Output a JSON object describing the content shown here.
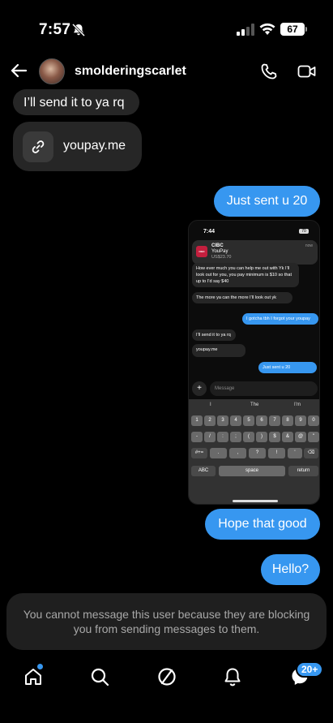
{
  "status_bar": {
    "time": "7:57",
    "battery": "67"
  },
  "header": {
    "username": "smolderingscarlet"
  },
  "messages": {
    "received_1": "I’ll send it to ya rq",
    "received_link": "youpay.me",
    "sent_1": "Just sent u 20",
    "sent_2": "Hope that good",
    "sent_3": "Hello?"
  },
  "embedded_screenshot": {
    "time": "7:44",
    "battery": "70",
    "notification": {
      "bank_logo": "CIBC",
      "bank": "CIBC",
      "app": "YouPay",
      "amount": "US$23.70",
      "time": "now"
    },
    "messages": [
      "How ever much you can help me out with Yk I’ll look out for you, you pay minimum is $10 so that up to I’d say $40",
      "The more ya can the more I’ll look out yk",
      "I gotcha tbh I forgot your youpay",
      "I’ll send it to ya rq",
      "youpay.me",
      "Just sent u 20"
    ],
    "input_placeholder": "Message",
    "predictions": [
      "I",
      "The",
      "I’m"
    ],
    "keys": {
      "row1": [
        "1",
        "2",
        "3",
        "4",
        "5",
        "6",
        "7",
        "8",
        "9",
        "0"
      ],
      "row2": [
        "-",
        "/",
        ":",
        ";",
        "(",
        ")",
        "$",
        "&",
        "@",
        "\""
      ],
      "row3": [
        "#+=",
        ".",
        ",",
        "?",
        "!",
        "'",
        "⌫"
      ],
      "row4": [
        "ABC",
        "space",
        "return"
      ]
    }
  },
  "blocked_notice": {
    "line1": "You cannot message this user because they are blocking",
    "line2": "you from sending messages to them."
  },
  "nav": {
    "messages_badge": "20+"
  },
  "colors": {
    "background": "#000000",
    "sent_bubble": "#3797f0",
    "received_bubble": "#262626",
    "notice_bg": "#1f1f1f"
  },
  "icons": [
    "mute-bell-icon",
    "cellular-signal-icon",
    "wifi-icon",
    "back-arrow-icon",
    "phone-icon",
    "video-camera-icon",
    "link-icon",
    "home-icon",
    "search-icon",
    "explore-icon",
    "notifications-bell-icon",
    "messenger-icon"
  ]
}
